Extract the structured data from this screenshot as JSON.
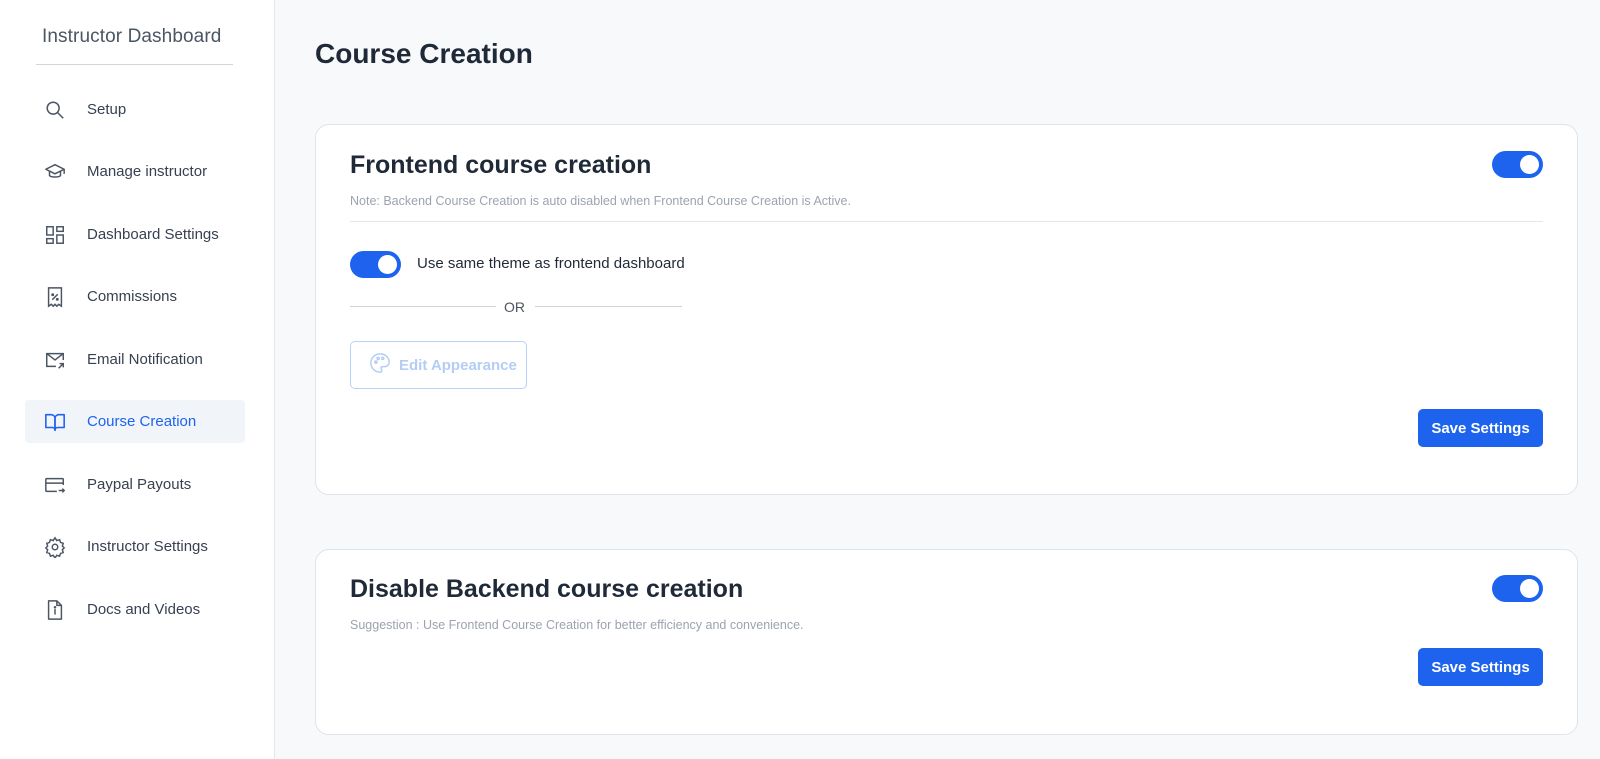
{
  "sidebar": {
    "title": "Instructor Dashboard",
    "items": [
      {
        "label": "Setup",
        "icon": "search-icon",
        "active": false
      },
      {
        "label": "Manage instructor",
        "icon": "graduation-cap-icon",
        "active": false
      },
      {
        "label": "Dashboard Settings",
        "icon": "dashboard-grid-icon",
        "active": false
      },
      {
        "label": "Commissions",
        "icon": "percent-receipt-icon",
        "active": false
      },
      {
        "label": "Email Notification",
        "icon": "mail-arrow-icon",
        "active": false
      },
      {
        "label": "Course Creation",
        "icon": "book-open-icon",
        "active": true
      },
      {
        "label": "Paypal Payouts",
        "icon": "credit-card-transfer-icon",
        "active": false
      },
      {
        "label": "Instructor Settings",
        "icon": "gear-icon",
        "active": false
      },
      {
        "label": "Docs and Videos",
        "icon": "document-info-icon",
        "active": false
      }
    ]
  },
  "main": {
    "page_title": "Course Creation",
    "frontend_card": {
      "title": "Frontend course creation",
      "enabled": true,
      "note": "Note: Backend Course Creation is auto disabled when Frontend Course Creation is Active.",
      "same_theme_label": "Use same theme as frontend dashboard",
      "same_theme_enabled": true,
      "or_text": "OR",
      "edit_appearance_label": "Edit Appearance",
      "save_label": "Save Settings"
    },
    "backend_card": {
      "title": "Disable Backend course creation",
      "enabled": true,
      "note": "Suggestion : Use Frontend Course Creation for better efficiency and convenience.",
      "save_label": "Save Settings"
    }
  },
  "colors": {
    "accent": "#1d63ed",
    "active_bg": "#f1f5f9",
    "muted_text": "#9ca3af"
  }
}
